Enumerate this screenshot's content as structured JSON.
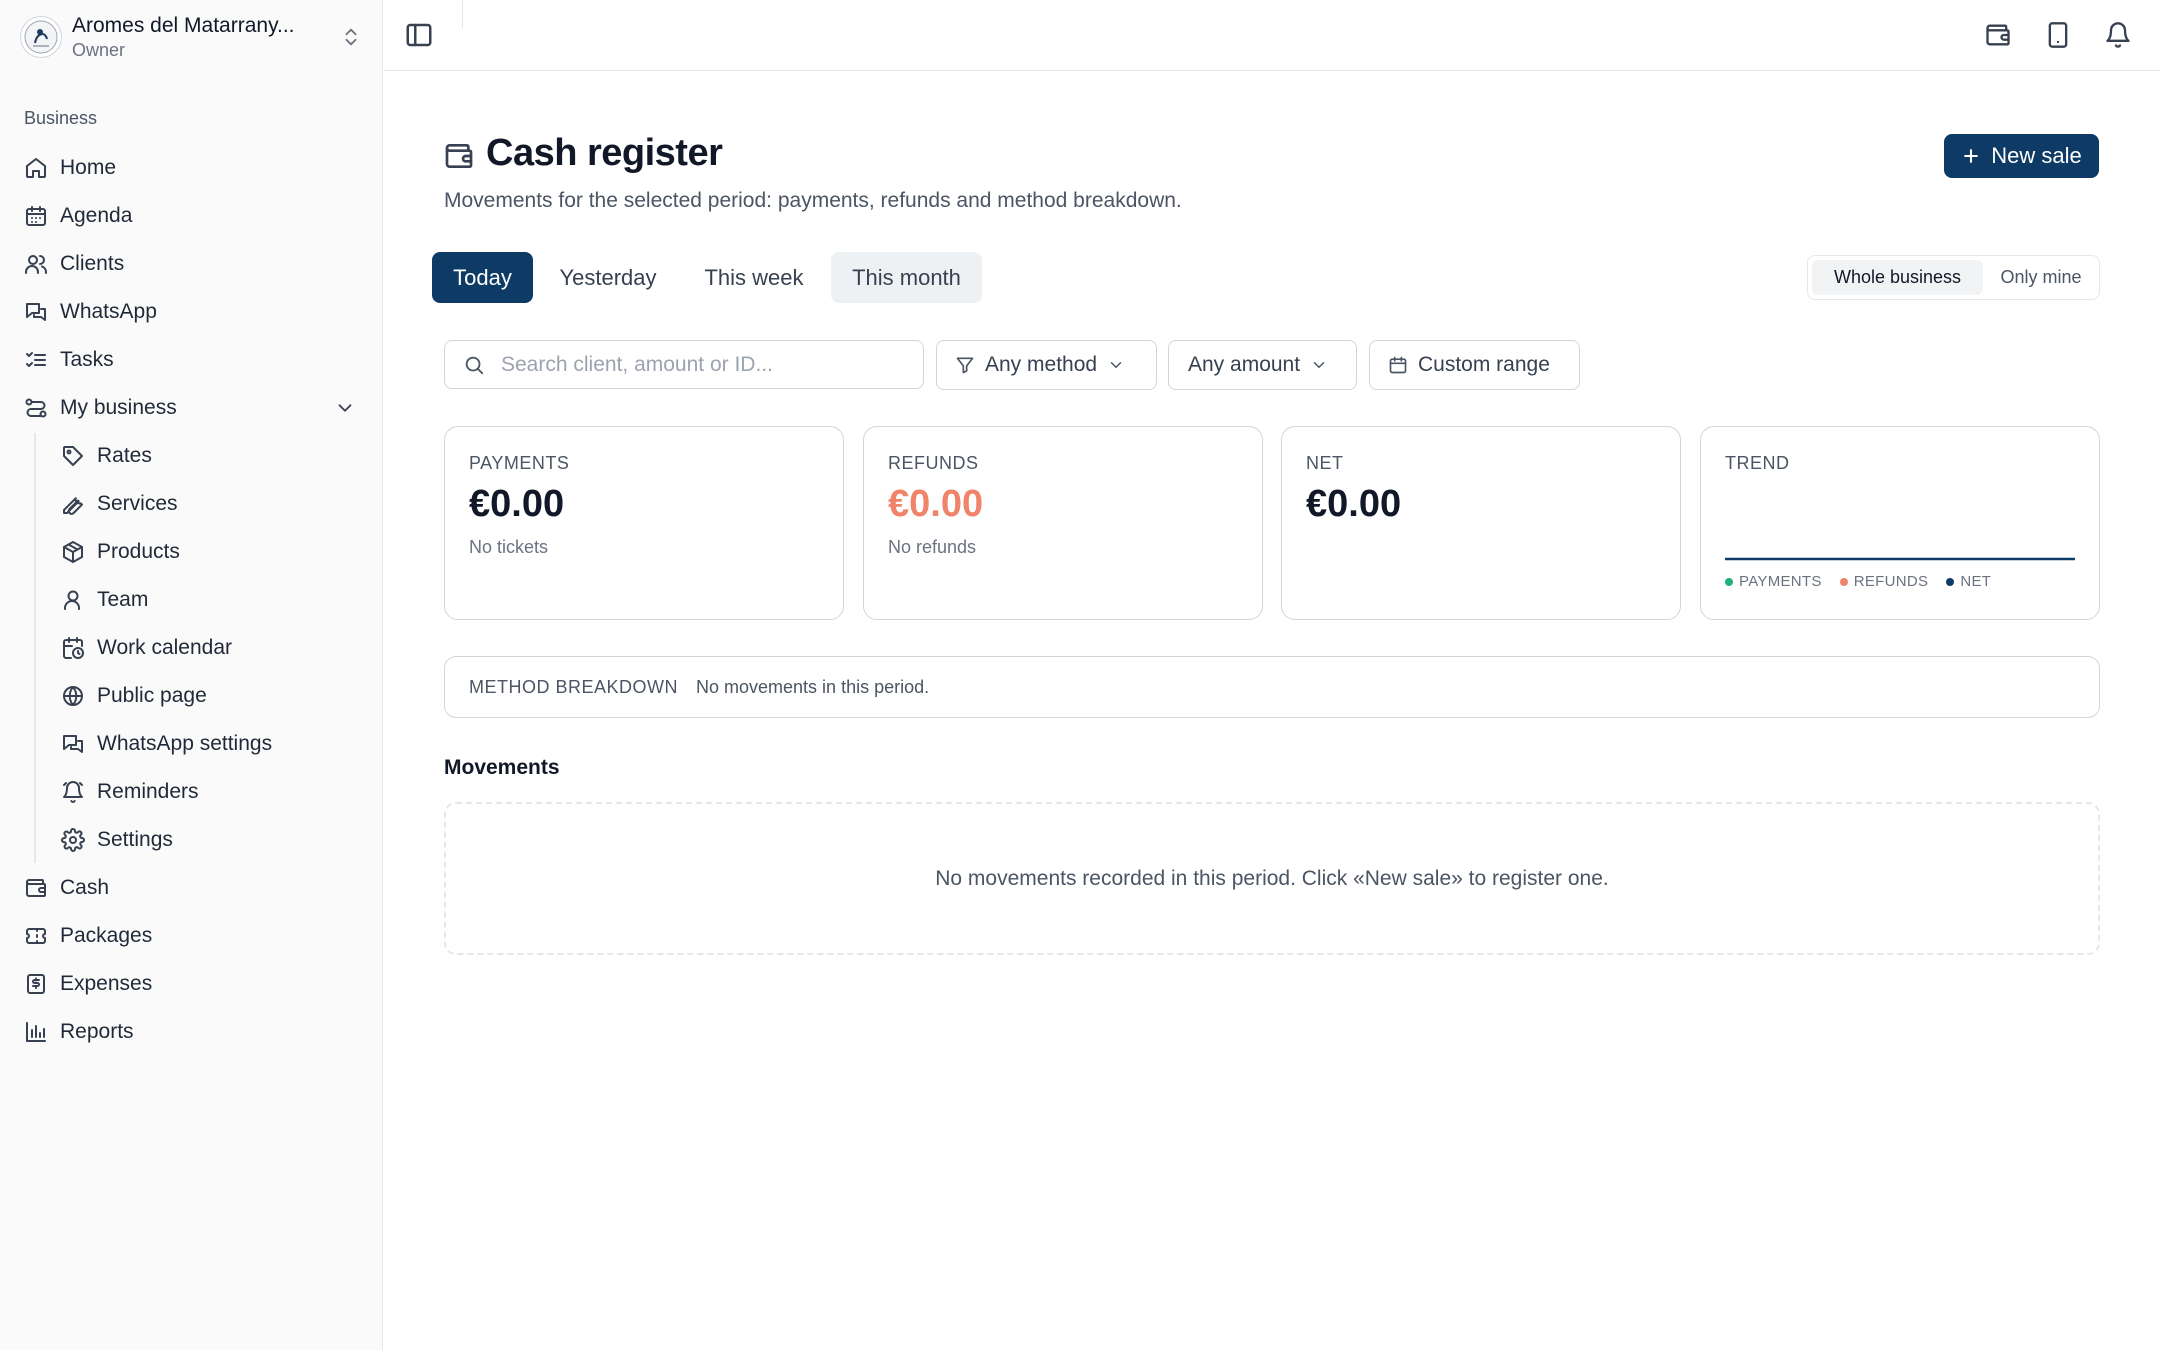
{
  "account": {
    "name": "Aromes del Matarrany...",
    "role": "Owner",
    "logo_text": "Aromes"
  },
  "sidebar": {
    "section_label": "Business",
    "items": [
      {
        "label": "Home",
        "icon": "home-icon"
      },
      {
        "label": "Agenda",
        "icon": "calendar-icon"
      },
      {
        "label": "Clients",
        "icon": "users-icon"
      },
      {
        "label": "WhatsApp",
        "icon": "chat-icon"
      },
      {
        "label": "Tasks",
        "icon": "list-checks-icon"
      },
      {
        "label": "My business",
        "icon": "route-icon",
        "expanded": true
      }
    ],
    "sub_items": [
      {
        "label": "Rates",
        "icon": "tag-icon"
      },
      {
        "label": "Services",
        "icon": "wrench-icon"
      },
      {
        "label": "Products",
        "icon": "box-icon"
      },
      {
        "label": "Team",
        "icon": "user-icon"
      },
      {
        "label": "Work calendar",
        "icon": "calendar-clock-icon"
      },
      {
        "label": "Public page",
        "icon": "globe-icon"
      },
      {
        "label": "WhatsApp settings",
        "icon": "chat-icon"
      },
      {
        "label": "Reminders",
        "icon": "bell-ring-icon"
      },
      {
        "label": "Settings",
        "icon": "gear-icon"
      }
    ],
    "bottom_items": [
      {
        "label": "Cash",
        "icon": "wallet-icon"
      },
      {
        "label": "Packages",
        "icon": "ticket-icon"
      },
      {
        "label": "Expenses",
        "icon": "receipt-icon"
      },
      {
        "label": "Reports",
        "icon": "bar-chart-icon"
      }
    ]
  },
  "topbar": {
    "icons": [
      "wallet-icon",
      "tablet-icon",
      "bell-icon"
    ]
  },
  "page": {
    "title": "Cash register",
    "subtitle": "Movements for the selected period: payments, refunds and method breakdown.",
    "new_sale_label": "New sale"
  },
  "periods": {
    "options": [
      "Today",
      "Yesterday",
      "This week",
      "This month"
    ],
    "selected": "Today"
  },
  "scope": {
    "options": [
      "Whole business",
      "Only mine"
    ],
    "selected": "Whole business"
  },
  "filters": {
    "search_placeholder": "Search client, amount or ID...",
    "search_value": "",
    "method_label": "Any method",
    "amount_label": "Any amount",
    "range_label": "Custom range"
  },
  "stats": {
    "payments": {
      "label": "PAYMENTS",
      "value": "€0.00",
      "note": "No tickets"
    },
    "refunds": {
      "label": "REFUNDS",
      "value": "€0.00",
      "note": "No refunds"
    },
    "net": {
      "label": "NET",
      "value": "€0.00"
    },
    "trend": {
      "label": "TREND",
      "legend": [
        "PAYMENTS",
        "REFUNDS",
        "NET"
      ]
    }
  },
  "breakdown": {
    "label": "METHOD BREAKDOWN",
    "text": "No movements in this period."
  },
  "movements": {
    "title": "Movements",
    "empty_text": "No movements recorded in this period. Click «New sale» to register one."
  },
  "colors": {
    "primary": "#0d3b66",
    "payments": "#22b07d",
    "refunds": "#f0846b",
    "net": "#0d3b66"
  }
}
